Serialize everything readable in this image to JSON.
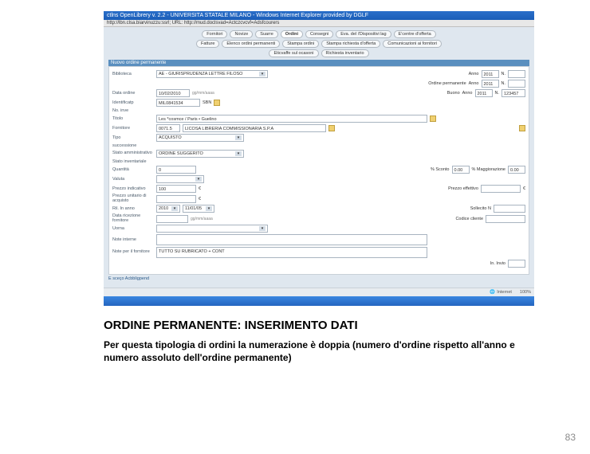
{
  "ie": {
    "title": "ctlns OpenLibrery v. 2.2 - UNIVERSITA STATALE MILANO - Windows Internet Explorer provided by DGLF",
    "address": "http://lbn.clsa.biarvinuzzu:ssrl; URL: http://mud.doclsvad=Actczcvcvf=Adsfcourers"
  },
  "tabs_row1": [
    "Fornitori",
    "Novize",
    "Suarre",
    "Ordini",
    "Consegni",
    "Eva. del i'Dispositivi lag",
    "E'centre d'offerta"
  ],
  "tabs_row2": [
    "Fatture",
    "Elenco ordini permanenti",
    "Stampa ordini",
    "Stampa richiesta d'offerta",
    "Comunicazioni ai fornitori"
  ],
  "tabs_row3": [
    "Eticvaffe sul ocasoni",
    "Richiesta inventario"
  ],
  "section_title": "Nuovo ordine permanente",
  "form": {
    "biblioteca_label": "Biblioteca",
    "biblioteca_value": "AE - GIURISPRUDENZA LETTRE FILOSO",
    "anno_label": "Anno",
    "anno_value": "2011",
    "n_label": "N.",
    "ordine_perm_label": "Ordine permanente",
    "ordine_perm_anno": "Anno",
    "ordine_perm_anno_val": "2011",
    "ordine_perm_n": "N.",
    "data_ordine_label": "Data ordine",
    "data_ordine_value": "10/02/2010",
    "data_hint": "gg/mm/aaaa",
    "buono_label": "Buono",
    "buono_anno": "Anno",
    "buono_anno_val": "2011",
    "buono_n": "N.",
    "buono_n_val": "123457",
    "identifying_label": "Identificatp",
    "identifying_value": "MIL0841534",
    "sbn_label": "SBN",
    "noninv_label": "No. inve",
    "titolo_label": "Titolo",
    "titolo_value": "Les *cosmce / Paris • Guelino",
    "fornitore_label": "Fornitore",
    "fornitore_code": "0071.5",
    "fornitore_name": "LICOSA LIBRERIA COMMISSIONARIA S.P.A",
    "tipo_label": "Tipo",
    "tipo_value": "ACQUISTO",
    "succ_label": "successione",
    "stato_amm_label": "Stato amministrativo",
    "stato_amm_value": "ORDINE SUGGERITO",
    "stato_inv_label": "Stato inventariale",
    "quantita_label": "Quantità",
    "quantita_value": "0",
    "sconto_label": "% Sconto",
    "sconto_value": "0.00",
    "maggio_label": "% Maggiorazione",
    "maggio_value": "0.00",
    "valuta_label": "Valuta",
    "prezzo_ind_label": "Prezzo indicativo",
    "prezzo_ind_value": "100",
    "prezzo_ind_cur": "€",
    "prezzo_eff_label": "Prezzo effettivo",
    "prezzo_eff_cur": "€",
    "prezzo_unit_label": "Prezzo unitario di acquisto",
    "prezzo_unit_cur": "€",
    "ril_label": "Ril. In anno",
    "ril_anno": "2010",
    "ril_data": "11/01/05",
    "sollecito_label": "Sollecito N",
    "data_ric_label": "Data ricezione fornitore",
    "data_ric_hint": "gg/mm/aaaa",
    "codice_cliente_label": "Codice cliente",
    "uorna_label": "Uorna",
    "note_interne_label": "Note interne",
    "note_ford_label": "Note per il fornitore",
    "note_ford_value": "TUTTO SU RUBRICATO + CONT",
    "invio_label": "In. Invio"
  },
  "statusbar": {
    "left": "E sceço Acbbligpend",
    "right_globe": "Internet",
    "right_zoom": "100%"
  },
  "caption": {
    "heading": "ORDINE PERMANENTE: INSERIMENTO DATI",
    "body": "Per questa tipologia di ordini la numerazione è doppia (numero d'ordine rispetto all'anno e numero assoluto dell'ordine permanente)"
  },
  "page_number": "83"
}
